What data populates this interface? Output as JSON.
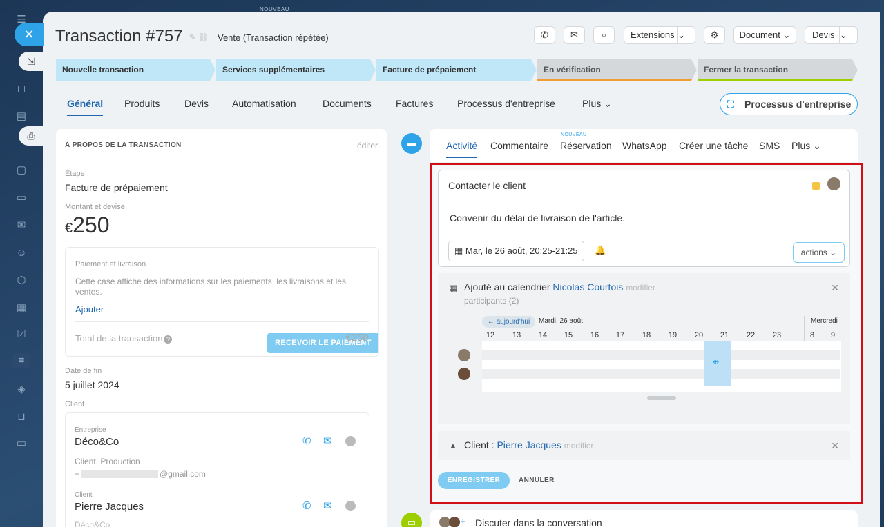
{
  "top": {
    "nouveau": "NOUVEAU"
  },
  "header": {
    "title": "Transaction #757",
    "subtitle": "Vente (Transaction répétée)",
    "buttons": {
      "extensions": "Extensions",
      "document": "Document",
      "devis": "Devis"
    }
  },
  "stages": [
    "Nouvelle transaction",
    "Services supplémentaires",
    "Facture de prépaiement",
    "En vérification",
    "Fermer la transaction"
  ],
  "tabs": [
    "Général",
    "Produits",
    "Devis",
    "Automatisation",
    "Documents",
    "Factures",
    "Processus d'entreprise",
    "Plus"
  ],
  "bp_button": "Processus d'entreprise",
  "about": {
    "title": "À PROPOS DE LA TRANSACTION",
    "edit": "éditer",
    "stage_label": "Étape",
    "stage_value": "Facture de prépaiement",
    "amount_label": "Montant et devise",
    "currency": "€",
    "amount": "250",
    "pay_button": "RECEVOIR LE PAIEMENT",
    "payment_title": "Paiement et livraison",
    "payment_text": "Cette case affiche des informations sur les paiements, les livraisons et les ventes.",
    "add_link": "Ajouter",
    "total_label": "Total de la transaction",
    "total_value": "€250",
    "end_date_label": "Date de fin",
    "end_date": "5 juillet 2024",
    "client_label": "Client",
    "company_label": "Entreprise",
    "company_name": "Déco&Co",
    "company_sub": "Client, Production",
    "company_email": "@gmail.com",
    "contact_label": "Client",
    "contact_name": "Pierre Jacques",
    "contact_company": "Déco&Co"
  },
  "activity": {
    "nouveau": "NOUVEAU",
    "tabs": [
      "Activité",
      "Commentaire",
      "Réservation",
      "WhatsApp",
      "Créer une tâche",
      "SMS",
      "Plus"
    ],
    "task_title": "Contacter le client",
    "task_text": "Convenir du délai de livraison de l'article.",
    "date": "Mar, le 26 août, 20:25-21:25",
    "actions": "actions",
    "calendar_added": "Ajouté au calendrier",
    "calendar_user": "Nicolas Courtois",
    "modify": "modifier",
    "participants": "participants (2)",
    "today_btn": "← aujourd'hui",
    "day_label": "Mardi, 26 août",
    "day2_label": "Mercredi",
    "hours": [
      "12",
      "13",
      "14",
      "15",
      "16",
      "17",
      "18",
      "19",
      "20",
      "21",
      "22",
      "23"
    ],
    "hours2": [
      "8",
      "9"
    ],
    "client_label": "Client :",
    "client_name": "Pierre Jacques",
    "client_modify": "modifier",
    "save": "ENREGISTRER",
    "cancel": "ANNULER",
    "chat": "Discuter dans la conversation"
  },
  "colors": {
    "accent": "#2fa3e8",
    "highlight": "#d20f16",
    "link": "#2067b0"
  }
}
